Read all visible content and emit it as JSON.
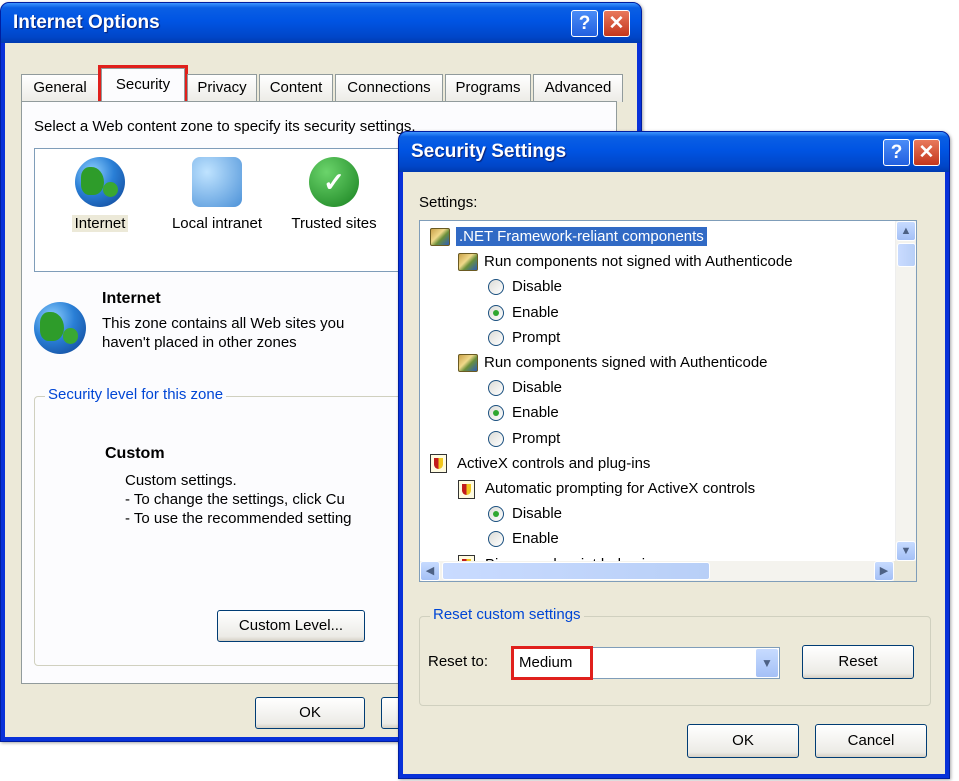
{
  "internet_options": {
    "title": "Internet Options",
    "help_btn": "?",
    "close_btn": "✕",
    "tabs": [
      "General",
      "Security",
      "Privacy",
      "Content",
      "Connections",
      "Programs",
      "Advanced"
    ],
    "active_tab": "Security",
    "instruction": "Select a Web content zone to specify its security settings.",
    "zones": [
      "Internet",
      "Local intranet",
      "Trusted sites"
    ],
    "zone_title": "Internet",
    "zone_desc_1": "This zone contains all Web sites you",
    "zone_desc_2": "haven't placed in other zones",
    "level_legend": "Security level for this zone",
    "level_name": "Custom",
    "level_desc_1": "Custom settings.",
    "level_desc_2": "- To change the settings, click Cu",
    "level_desc_3": "- To use the recommended setting",
    "custom_level_btn": "Custom Level...",
    "ok_btn": "OK"
  },
  "security_settings": {
    "title": "Security Settings",
    "help_btn": "?",
    "close_btn": "✕",
    "settings_label": "Settings:",
    "items": [
      {
        "text": ".NET Framework-reliant components",
        "kind": "category",
        "icon": "settings-category-icon",
        "selected": true
      },
      {
        "text": "Run components not signed with Authenticode",
        "kind": "setting",
        "icon": "settings-category-icon"
      },
      {
        "text": "Disable",
        "kind": "radio",
        "checked": false
      },
      {
        "text": "Enable",
        "kind": "radio",
        "checked": true
      },
      {
        "text": "Prompt",
        "kind": "radio",
        "checked": false
      },
      {
        "text": "Run components signed with Authenticode",
        "kind": "setting",
        "icon": "settings-category-icon"
      },
      {
        "text": "Disable",
        "kind": "radio",
        "checked": false
      },
      {
        "text": "Enable",
        "kind": "radio",
        "checked": true
      },
      {
        "text": "Prompt",
        "kind": "radio",
        "checked": false
      },
      {
        "text": "ActiveX controls and plug-ins",
        "kind": "category2",
        "icon": "shield-icon"
      },
      {
        "text": "Automatic prompting for ActiveX controls",
        "kind": "setting",
        "icon": "shield-icon"
      },
      {
        "text": "Disable",
        "kind": "radio",
        "checked": true
      },
      {
        "text": "Enable",
        "kind": "radio",
        "checked": false
      },
      {
        "text": "Binary and script behaviors",
        "kind": "setting",
        "icon": "shield-icon"
      }
    ],
    "reset_legend": "Reset custom settings",
    "reset_to_label": "Reset to:",
    "reset_value": "Medium",
    "reset_btn": "Reset",
    "ok_btn": "OK",
    "cancel_btn": "Cancel"
  }
}
